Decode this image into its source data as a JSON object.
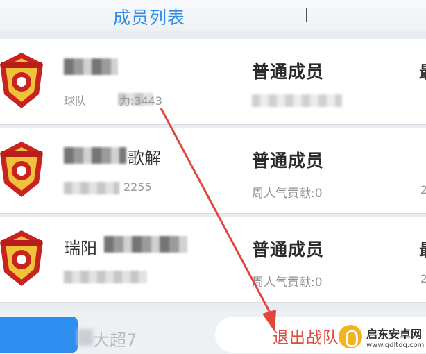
{
  "header": {
    "tab_title": "成员列表"
  },
  "members": [
    {
      "name_visible": "",
      "sub_visible": "球队",
      "sub_tail": "力:3443",
      "role": "普通成员",
      "contrib_label": "",
      "edge_char": "最",
      "edge_sub": ""
    },
    {
      "name_visible": "",
      "name_tail": "歌解",
      "sub_tail": "2255",
      "role": "普通成员",
      "contrib_label": "周人气贡献:0",
      "edge_char": "",
      "edge_sub": "2"
    },
    {
      "name_visible": "",
      "name_prefix": "瑞阳",
      "role": "普通成员",
      "contrib_label": "周人气贡献:0",
      "edge_char": "最",
      "edge_sub": "2"
    }
  ],
  "bottom": {
    "league_text": "大超7",
    "exit_label": "退出战队"
  },
  "watermark": {
    "brand": "启东安卓网",
    "url": "www.qdltdq.com"
  },
  "colors": {
    "accent_blue": "#2e8ef0",
    "title_blue": "#2f8be6",
    "exit_red": "#e04a3a",
    "arrow_red": "#e2453a"
  }
}
